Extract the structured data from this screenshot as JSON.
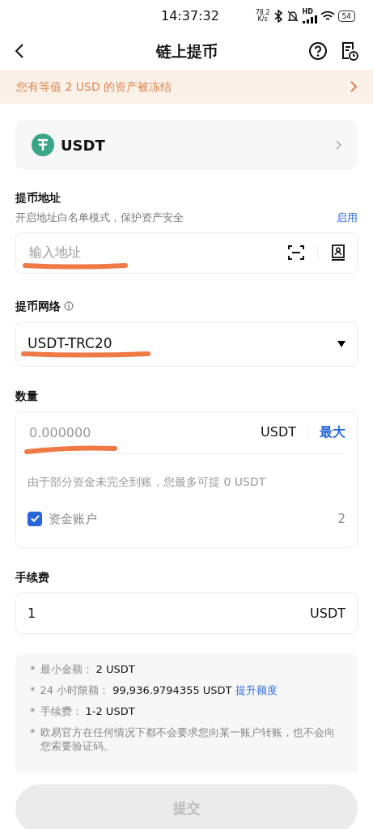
{
  "status_bar": {
    "time": "14:37:32",
    "speed": "78.2",
    "speed_unit": "K/s",
    "network_label": "HD",
    "battery": "54"
  },
  "header": {
    "title": "链上提币"
  },
  "notice": {
    "text": "您有等值 2 USD 的资产被冻结"
  },
  "coin": {
    "name": "USDT"
  },
  "address": {
    "label": "提币地址",
    "hint": "开启地址白名单模式，保护资产安全",
    "action": "启用",
    "placeholder": "输入地址"
  },
  "network": {
    "label": "提币网络",
    "value": "USDT-TRC20"
  },
  "amount": {
    "label": "数量",
    "placeholder": "0.000000",
    "unit": "USDT",
    "max": "最大",
    "note": "由于部分资金未完全到账，您最多可提 0 USDT",
    "account": {
      "label": "资金账户",
      "value": "2",
      "checked": true
    }
  },
  "fee": {
    "label": "手续费",
    "value": "1",
    "unit": "USDT"
  },
  "notes": [
    {
      "bullet": "*",
      "label": "最小金额：",
      "value": "2 USDT"
    },
    {
      "bullet": "*",
      "label": "24 小时限额：",
      "value": "99,936.9794355 USDT",
      "link": "提升额度"
    },
    {
      "bullet": "*",
      "label": "手续费：",
      "value": "1-2 USDT"
    },
    {
      "bullet": "*",
      "label": "欧易官方在任何情况下都不会要求您向某一账户转账，也不会向您索要验证码。"
    }
  ],
  "submit": {
    "label": "提交",
    "disabled": true
  }
}
